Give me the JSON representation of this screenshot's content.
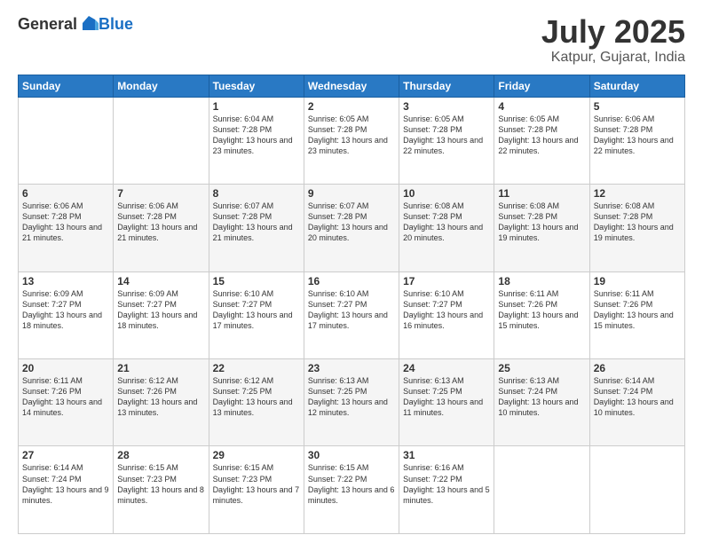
{
  "logo": {
    "general": "General",
    "blue": "Blue"
  },
  "header": {
    "month_year": "July 2025",
    "location": "Katpur, Gujarat, India"
  },
  "weekdays": [
    "Sunday",
    "Monday",
    "Tuesday",
    "Wednesday",
    "Thursday",
    "Friday",
    "Saturday"
  ],
  "weeks": [
    [
      {
        "day": "",
        "sunrise": "",
        "sunset": "",
        "daylight": ""
      },
      {
        "day": "",
        "sunrise": "",
        "sunset": "",
        "daylight": ""
      },
      {
        "day": "1",
        "sunrise": "Sunrise: 6:04 AM",
        "sunset": "Sunset: 7:28 PM",
        "daylight": "Daylight: 13 hours and 23 minutes."
      },
      {
        "day": "2",
        "sunrise": "Sunrise: 6:05 AM",
        "sunset": "Sunset: 7:28 PM",
        "daylight": "Daylight: 13 hours and 23 minutes."
      },
      {
        "day": "3",
        "sunrise": "Sunrise: 6:05 AM",
        "sunset": "Sunset: 7:28 PM",
        "daylight": "Daylight: 13 hours and 22 minutes."
      },
      {
        "day": "4",
        "sunrise": "Sunrise: 6:05 AM",
        "sunset": "Sunset: 7:28 PM",
        "daylight": "Daylight: 13 hours and 22 minutes."
      },
      {
        "day": "5",
        "sunrise": "Sunrise: 6:06 AM",
        "sunset": "Sunset: 7:28 PM",
        "daylight": "Daylight: 13 hours and 22 minutes."
      }
    ],
    [
      {
        "day": "6",
        "sunrise": "Sunrise: 6:06 AM",
        "sunset": "Sunset: 7:28 PM",
        "daylight": "Daylight: 13 hours and 21 minutes."
      },
      {
        "day": "7",
        "sunrise": "Sunrise: 6:06 AM",
        "sunset": "Sunset: 7:28 PM",
        "daylight": "Daylight: 13 hours and 21 minutes."
      },
      {
        "day": "8",
        "sunrise": "Sunrise: 6:07 AM",
        "sunset": "Sunset: 7:28 PM",
        "daylight": "Daylight: 13 hours and 21 minutes."
      },
      {
        "day": "9",
        "sunrise": "Sunrise: 6:07 AM",
        "sunset": "Sunset: 7:28 PM",
        "daylight": "Daylight: 13 hours and 20 minutes."
      },
      {
        "day": "10",
        "sunrise": "Sunrise: 6:08 AM",
        "sunset": "Sunset: 7:28 PM",
        "daylight": "Daylight: 13 hours and 20 minutes."
      },
      {
        "day": "11",
        "sunrise": "Sunrise: 6:08 AM",
        "sunset": "Sunset: 7:28 PM",
        "daylight": "Daylight: 13 hours and 19 minutes."
      },
      {
        "day": "12",
        "sunrise": "Sunrise: 6:08 AM",
        "sunset": "Sunset: 7:28 PM",
        "daylight": "Daylight: 13 hours and 19 minutes."
      }
    ],
    [
      {
        "day": "13",
        "sunrise": "Sunrise: 6:09 AM",
        "sunset": "Sunset: 7:27 PM",
        "daylight": "Daylight: 13 hours and 18 minutes."
      },
      {
        "day": "14",
        "sunrise": "Sunrise: 6:09 AM",
        "sunset": "Sunset: 7:27 PM",
        "daylight": "Daylight: 13 hours and 18 minutes."
      },
      {
        "day": "15",
        "sunrise": "Sunrise: 6:10 AM",
        "sunset": "Sunset: 7:27 PM",
        "daylight": "Daylight: 13 hours and 17 minutes."
      },
      {
        "day": "16",
        "sunrise": "Sunrise: 6:10 AM",
        "sunset": "Sunset: 7:27 PM",
        "daylight": "Daylight: 13 hours and 17 minutes."
      },
      {
        "day": "17",
        "sunrise": "Sunrise: 6:10 AM",
        "sunset": "Sunset: 7:27 PM",
        "daylight": "Daylight: 13 hours and 16 minutes."
      },
      {
        "day": "18",
        "sunrise": "Sunrise: 6:11 AM",
        "sunset": "Sunset: 7:26 PM",
        "daylight": "Daylight: 13 hours and 15 minutes."
      },
      {
        "day": "19",
        "sunrise": "Sunrise: 6:11 AM",
        "sunset": "Sunset: 7:26 PM",
        "daylight": "Daylight: 13 hours and 15 minutes."
      }
    ],
    [
      {
        "day": "20",
        "sunrise": "Sunrise: 6:11 AM",
        "sunset": "Sunset: 7:26 PM",
        "daylight": "Daylight: 13 hours and 14 minutes."
      },
      {
        "day": "21",
        "sunrise": "Sunrise: 6:12 AM",
        "sunset": "Sunset: 7:26 PM",
        "daylight": "Daylight: 13 hours and 13 minutes."
      },
      {
        "day": "22",
        "sunrise": "Sunrise: 6:12 AM",
        "sunset": "Sunset: 7:25 PM",
        "daylight": "Daylight: 13 hours and 13 minutes."
      },
      {
        "day": "23",
        "sunrise": "Sunrise: 6:13 AM",
        "sunset": "Sunset: 7:25 PM",
        "daylight": "Daylight: 13 hours and 12 minutes."
      },
      {
        "day": "24",
        "sunrise": "Sunrise: 6:13 AM",
        "sunset": "Sunset: 7:25 PM",
        "daylight": "Daylight: 13 hours and 11 minutes."
      },
      {
        "day": "25",
        "sunrise": "Sunrise: 6:13 AM",
        "sunset": "Sunset: 7:24 PM",
        "daylight": "Daylight: 13 hours and 10 minutes."
      },
      {
        "day": "26",
        "sunrise": "Sunrise: 6:14 AM",
        "sunset": "Sunset: 7:24 PM",
        "daylight": "Daylight: 13 hours and 10 minutes."
      }
    ],
    [
      {
        "day": "27",
        "sunrise": "Sunrise: 6:14 AM",
        "sunset": "Sunset: 7:24 PM",
        "daylight": "Daylight: 13 hours and 9 minutes."
      },
      {
        "day": "28",
        "sunrise": "Sunrise: 6:15 AM",
        "sunset": "Sunset: 7:23 PM",
        "daylight": "Daylight: 13 hours and 8 minutes."
      },
      {
        "day": "29",
        "sunrise": "Sunrise: 6:15 AM",
        "sunset": "Sunset: 7:23 PM",
        "daylight": "Daylight: 13 hours and 7 minutes."
      },
      {
        "day": "30",
        "sunrise": "Sunrise: 6:15 AM",
        "sunset": "Sunset: 7:22 PM",
        "daylight": "Daylight: 13 hours and 6 minutes."
      },
      {
        "day": "31",
        "sunrise": "Sunrise: 6:16 AM",
        "sunset": "Sunset: 7:22 PM",
        "daylight": "Daylight: 13 hours and 5 minutes."
      },
      {
        "day": "",
        "sunrise": "",
        "sunset": "",
        "daylight": ""
      },
      {
        "day": "",
        "sunrise": "",
        "sunset": "",
        "daylight": ""
      }
    ]
  ]
}
